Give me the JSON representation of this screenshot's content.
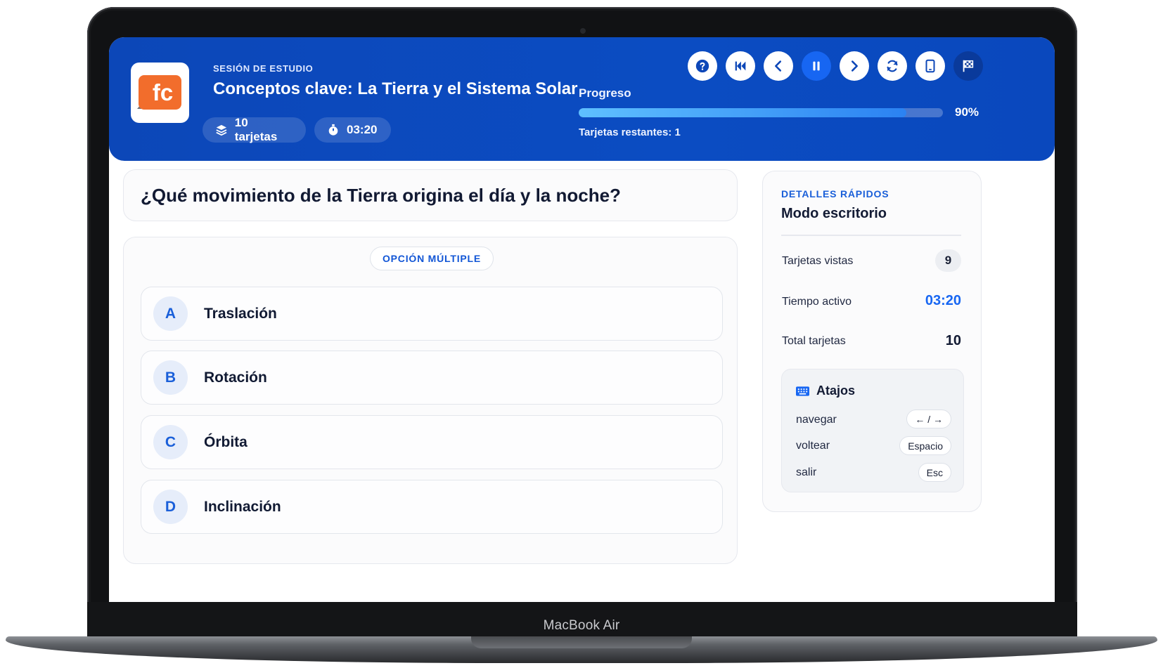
{
  "device": {
    "label": "MacBook Air"
  },
  "header": {
    "logo_text": "fc",
    "eyebrow": "SESIÓN DE ESTUDIO",
    "title": "Conceptos clave: La Tierra y el Sistema Solar",
    "cards_chip": "10 tarjetas",
    "timer_chip": "03:20",
    "progress_label": "Progreso",
    "progress_value": 0.9,
    "progress_pct": "90%",
    "remaining": "Tarjetas restantes: 1"
  },
  "controls": [
    {
      "name": "help-button",
      "icon": "help-icon"
    },
    {
      "name": "restart-button",
      "icon": "skip-back-icon"
    },
    {
      "name": "previous-button",
      "icon": "chevron-left-icon"
    },
    {
      "name": "pause-button",
      "icon": "pause-icon",
      "active": true
    },
    {
      "name": "next-button",
      "icon": "chevron-right-icon"
    },
    {
      "name": "shuffle-button",
      "icon": "refresh-icon"
    },
    {
      "name": "device-mode-button",
      "icon": "tablet-icon"
    },
    {
      "name": "finish-button",
      "icon": "flag-checkered-icon"
    }
  ],
  "question": {
    "text": "¿Qué movimiento de la Tierra origina el día y la noche?"
  },
  "answer_mode": "OPCIÓN MÚLTIPLE",
  "options": [
    {
      "letter": "A",
      "text": "Traslación"
    },
    {
      "letter": "B",
      "text": "Rotación"
    },
    {
      "letter": "C",
      "text": "Órbita"
    },
    {
      "letter": "D",
      "text": "Inclinación"
    }
  ],
  "details": {
    "eyebrow": "DETALLES RÁPIDOS",
    "title": "Modo escritorio",
    "viewed_label": "Tarjetas vistas",
    "viewed_value": "9",
    "active_time_label": "Tiempo activo",
    "active_time_value": "03:20",
    "total_label": "Total tarjetas",
    "total_value": "10",
    "shortcuts_title": "Atajos",
    "shortcuts": [
      {
        "action": "navegar",
        "key": "← / →"
      },
      {
        "action": "voltear",
        "key": "Espacio"
      },
      {
        "action": "salir",
        "key": "Esc"
      }
    ]
  },
  "colors": {
    "brand": "#0b4cc2",
    "accent": "#1766f2",
    "logo": "#f26d2c"
  }
}
